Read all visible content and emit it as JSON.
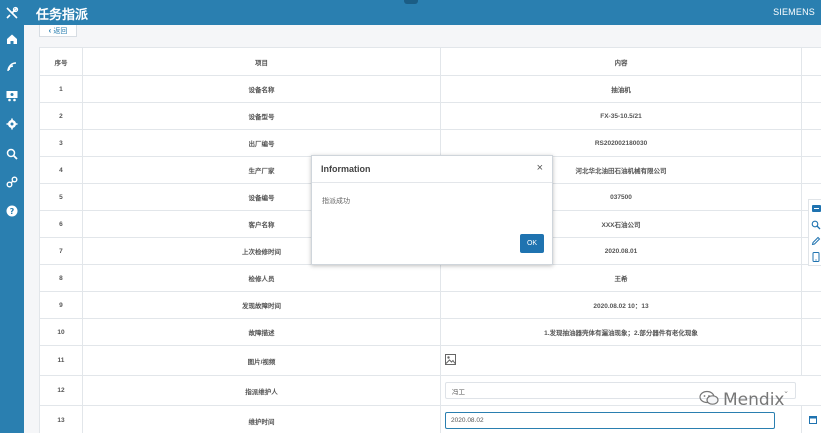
{
  "header": {
    "title": "任务指派",
    "brand": "SIEMENS"
  },
  "sidebar": {
    "icons": [
      "home-icon",
      "signal-icon",
      "team-icon",
      "gear-icon",
      "search-icon",
      "link-icon",
      "help-icon"
    ]
  },
  "back": {
    "label": "返回"
  },
  "table": {
    "headers": {
      "no": "序号",
      "item": "项目",
      "content": "内容"
    },
    "rows": [
      {
        "no": "1",
        "item": "设备名称",
        "content": "抽油机"
      },
      {
        "no": "2",
        "item": "设备型号",
        "content": "FX-35-10.5/21"
      },
      {
        "no": "3",
        "item": "出厂编号",
        "content": "RS202002180030"
      },
      {
        "no": "4",
        "item": "生产厂家",
        "content": "河北华北油田石油机械有限公司"
      },
      {
        "no": "5",
        "item": "设备编号",
        "content": "037500"
      },
      {
        "no": "6",
        "item": "客户名称",
        "content": "XXX石油公司"
      },
      {
        "no": "7",
        "item": "上次检修时间",
        "content": "2020.08.01"
      },
      {
        "no": "8",
        "item": "检修人员",
        "content": "王希"
      },
      {
        "no": "9",
        "item": "发现故障时间",
        "content": "2020.08.02 10：13"
      },
      {
        "no": "10",
        "item": "故障描述",
        "content": "1.发现抽油器壳体有漏油现象；2.部分器件有老化现象"
      },
      {
        "no": "11",
        "item": "图片/视频",
        "content": ""
      },
      {
        "no": "12",
        "item": "指派维护人",
        "content": "冯工"
      },
      {
        "no": "13",
        "item": "维护时间",
        "content": "2020.08.02"
      }
    ]
  },
  "dialog": {
    "title": "Information",
    "close": "×",
    "message": "指派成功",
    "ok_label": "OK"
  },
  "watermark": {
    "text": "Mendix"
  },
  "colors": {
    "brand_blue": "#2a7fb0",
    "ok_button": "#1f73b0"
  }
}
